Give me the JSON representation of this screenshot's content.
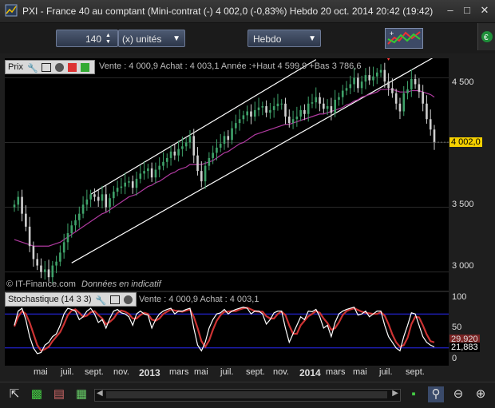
{
  "window": {
    "title": "PXI - France 40 au comptant (Mini-contrat  (-)   4 002,0 (-0,83%)     Hebdo  20 oct. 2014 20:42 (19:42)",
    "controls": [
      "minimize-icon",
      "maximize-icon",
      "close-icon"
    ]
  },
  "toolbar": {
    "units_value": "140",
    "units_label": "(x) unités",
    "period_label": "Hebdo"
  },
  "price_panel": {
    "label": "Prix",
    "info": "Vente : 4 000,9 Achat : 4 003,1 Année :+Haut 4 599,9 +Bas 3 786,6",
    "credit": "© IT-Finance.com",
    "credit_note": "Données en indicatif",
    "last_price": "4 002,0",
    "scale": [
      "4 500",
      "4 000",
      "3 500",
      "3 000"
    ],
    "colors": {
      "up": "#3fa26a",
      "down": "#cfcfcf",
      "ma": "#b03aa0",
      "channel": "#ffffff",
      "arrow": "#ff3a3a",
      "last_box": "#f5d000"
    }
  },
  "stoch_panel": {
    "label": "Stochastique (14 3 3)",
    "info": "Vente : 4 000,9 Achat : 4 003,1",
    "scale": [
      "100",
      "50",
      "0"
    ],
    "value_k": "21,883",
    "value_d": "29,920",
    "levels": [
      80,
      20
    ],
    "colors": {
      "k": "#ffffff",
      "d": "#cc3333",
      "levels": "#2a2aff"
    }
  },
  "time_axis": [
    "mai",
    "juil.",
    "sept.",
    "nov.",
    "2013",
    "mars",
    "mai",
    "juil.",
    "sept.",
    "nov.",
    "2014",
    "mars",
    "mai",
    "juil.",
    "sept."
  ],
  "chart_data": {
    "type": "candlestick",
    "title": "PXI - France 40 au comptant (Mini-contrat  (-)",
    "period": "Hebdo",
    "ylim": [
      2850,
      4650
    ],
    "x": [
      "mai",
      "juil.",
      "sept.",
      "nov.",
      "2013",
      "mars",
      "mai",
      "juil.",
      "sept.",
      "nov.",
      "2014",
      "mars",
      "mai",
      "juil.",
      "sept."
    ],
    "close": [
      3520,
      3580,
      3450,
      3350,
      3200,
      3100,
      3050,
      3000,
      3020,
      2960,
      3050,
      3080,
      3150,
      3230,
      3300,
      3360,
      3400,
      3450,
      3520,
      3560,
      3600,
      3580,
      3550,
      3600,
      3500,
      3570,
      3620,
      3650,
      3660,
      3690,
      3700,
      3650,
      3720,
      3760,
      3780,
      3800,
      3730,
      3790,
      3820,
      3850,
      3880,
      3930,
      3900,
      3950,
      3970,
      4000,
      4050,
      3900,
      3780,
      3700,
      3820,
      3880,
      3920,
      3960,
      3990,
      4050,
      4020,
      4110,
      4150,
      4180,
      4210,
      4240,
      4200,
      4250,
      4270,
      4280,
      4230,
      4250,
      4280,
      4300,
      4300,
      4200,
      4150,
      4180,
      4200,
      4250,
      4220,
      4300,
      4310,
      4350,
      4300,
      4260,
      4280,
      4230,
      4330,
      4350,
      4400,
      4420,
      4450,
      4500,
      4420,
      4470,
      4520,
      4480,
      4510,
      4540,
      4560,
      4470,
      4420,
      4380,
      4300,
      4240,
      4380,
      4410,
      4490,
      4450,
      4390,
      4300,
      4180,
      4100,
      4002
    ],
    "ma": [
      3250,
      3240,
      3230,
      3220,
      3210,
      3200,
      3200,
      3200,
      3200,
      3200,
      3210,
      3220,
      3230,
      3250,
      3270,
      3290,
      3310,
      3330,
      3350,
      3370,
      3390,
      3410,
      3430,
      3450,
      3460,
      3480,
      3500,
      3520,
      3540,
      3560,
      3580,
      3590,
      3600,
      3620,
      3640,
      3660,
      3670,
      3690,
      3700,
      3720,
      3740,
      3760,
      3770,
      3790,
      3800,
      3810,
      3830,
      3830,
      3830,
      3830,
      3840,
      3850,
      3860,
      3880,
      3900,
      3920,
      3930,
      3950,
      3970,
      3990,
      4000,
      4020,
      4040,
      4060,
      4070,
      4080,
      4090,
      4100,
      4110,
      4120,
      4130,
      4140,
      4140,
      4150,
      4160,
      4170,
      4180,
      4190,
      4200,
      4210,
      4220,
      4220,
      4230,
      4240,
      4250,
      4260,
      4270,
      4290,
      4300,
      4320,
      4330,
      4350,
      4360,
      4370,
      4380,
      4390,
      4410,
      4410,
      4410,
      4410,
      4400,
      4390,
      4390,
      4390,
      4400,
      4400,
      4400,
      4390,
      4380,
      4370,
      4350
    ],
    "stoch_k": [
      60,
      85,
      90,
      70,
      40,
      20,
      10,
      12,
      25,
      30,
      40,
      45,
      60,
      80,
      90,
      88,
      85,
      70,
      75,
      85,
      90,
      80,
      65,
      70,
      55,
      72,
      85,
      88,
      82,
      80,
      75,
      60,
      80,
      85,
      80,
      78,
      55,
      70,
      80,
      85,
      88,
      90,
      80,
      85,
      85,
      88,
      90,
      55,
      25,
      15,
      30,
      55,
      70,
      80,
      82,
      88,
      80,
      85,
      88,
      90,
      92,
      90,
      80,
      85,
      85,
      80,
      62,
      70,
      82,
      85,
      85,
      55,
      30,
      45,
      60,
      75,
      70,
      85,
      84,
      88,
      75,
      55,
      60,
      40,
      65,
      80,
      85,
      88,
      90,
      92,
      78,
      80,
      85,
      75,
      80,
      85,
      85,
      60,
      40,
      30,
      20,
      15,
      40,
      60,
      82,
      80,
      60,
      40,
      30,
      25,
      21.883
    ],
    "stoch_d": [
      58,
      75,
      85,
      80,
      65,
      45,
      25,
      15,
      18,
      22,
      32,
      40,
      48,
      62,
      78,
      86,
      88,
      82,
      75,
      77,
      83,
      85,
      78,
      72,
      62,
      66,
      72,
      82,
      86,
      84,
      80,
      72,
      72,
      78,
      82,
      80,
      70,
      68,
      72,
      80,
      84,
      88,
      86,
      85,
      84,
      86,
      88,
      75,
      55,
      32,
      22,
      33,
      52,
      68,
      78,
      84,
      84,
      85,
      85,
      88,
      90,
      91,
      88,
      85,
      84,
      84,
      76,
      72,
      72,
      80,
      84,
      78,
      60,
      45,
      45,
      60,
      68,
      76,
      80,
      85,
      82,
      72,
      64,
      52,
      55,
      65,
      78,
      85,
      88,
      90,
      87,
      84,
      82,
      81,
      80,
      80,
      83,
      77,
      62,
      44,
      30,
      22,
      25,
      38,
      62,
      75,
      74,
      60,
      44,
      32,
      29.92
    ]
  }
}
